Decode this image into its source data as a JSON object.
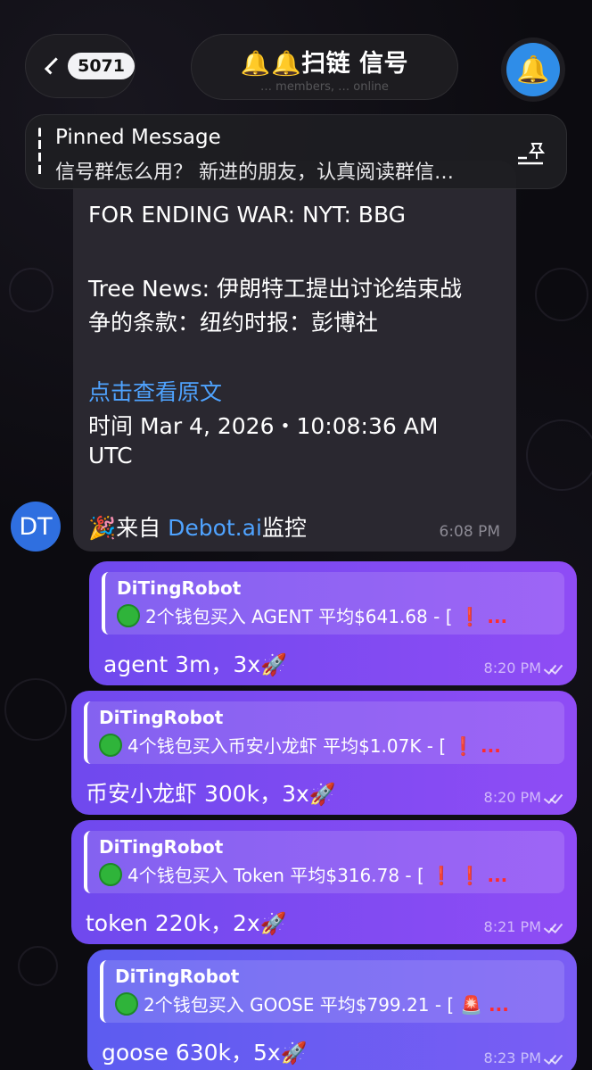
{
  "header": {
    "unread_count": "5071",
    "title": "🔔🔔扫链 信号",
    "subtitle": "… members, … online"
  },
  "pinned": {
    "label": "Pinned Message",
    "text": "信号群怎么用？ 新进的朋友，认真阅读群信…"
  },
  "news_message": {
    "line1": "FOR ENDING WAR: NYT: BBG",
    "line2": "Tree News: 伊朗特工提出讨论结束战",
    "line3": "争的条款：纽约时报：彭博社",
    "link": "点击查看原文",
    "time_line1": "时间 Mar 4, 2026・10:08:36 AM",
    "time_line2": "UTC",
    "source_prefix": "🎉来自 ",
    "source_link": "Debot.ai",
    "source_suffix": "监控",
    "timestamp": "6:08 PM",
    "avatar_initials": "DT"
  },
  "messages": [
    {
      "reply_name": "DiTingRobot",
      "reply_text": "2个钱包买入 AGENT 平均$641.68 - [",
      "reply_tail": " ❗ ...",
      "body": "agent 3m，3x",
      "time": "8:20 PM"
    },
    {
      "reply_name": "DiTingRobot",
      "reply_text": "4个钱包买入币安小龙虾 平均$1.07K - [",
      "reply_tail": " ❗ ...",
      "body": "币安小龙虾 300k，3x",
      "time": "8:20 PM"
    },
    {
      "reply_name": "DiTingRobot",
      "reply_text": "4个钱包买入 Token 平均$316.78 - [",
      "reply_tail": " ❗ ❗ ...",
      "body": "token 220k，2x",
      "time": "8:21 PM"
    },
    {
      "reply_name": "DiTingRobot",
      "reply_text": "2个钱包买入 GOOSE 平均$799.21 - [",
      "reply_tail": " 🚨 ...",
      "body": "goose 630k，5x",
      "time": "8:23 PM"
    }
  ],
  "colors": {
    "bubble_purple": "#7a4bf2",
    "link_blue": "#4fa3ff",
    "avatar_blue": "#2f6fe0"
  }
}
